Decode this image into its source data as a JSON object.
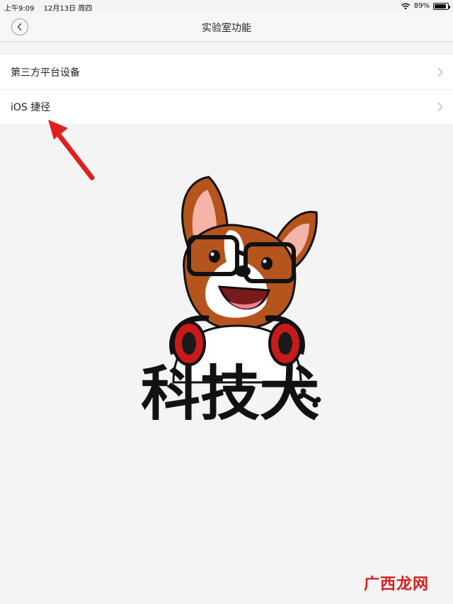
{
  "status_bar": {
    "time": "上午9:09",
    "date": "12月13日 周四",
    "battery_percent": "89%",
    "battery_level": 0.89,
    "wifi_icon": "wifi-icon",
    "battery_icon": "battery-icon"
  },
  "nav": {
    "title": "实验室功能",
    "back_icon": "chevron-left-icon"
  },
  "list": {
    "items": [
      {
        "label": "第三方平台设备",
        "icon": "chevron-right-icon"
      },
      {
        "label": "iOS 捷径",
        "icon": "chevron-right-icon"
      }
    ]
  },
  "mascot": {
    "text": "科技犬"
  },
  "watermark": {
    "text": "广西龙网"
  },
  "colors": {
    "background": "#f4f4f4",
    "list_background": "#ffffff",
    "arrow": "#e02020",
    "watermark": "#d32020"
  }
}
